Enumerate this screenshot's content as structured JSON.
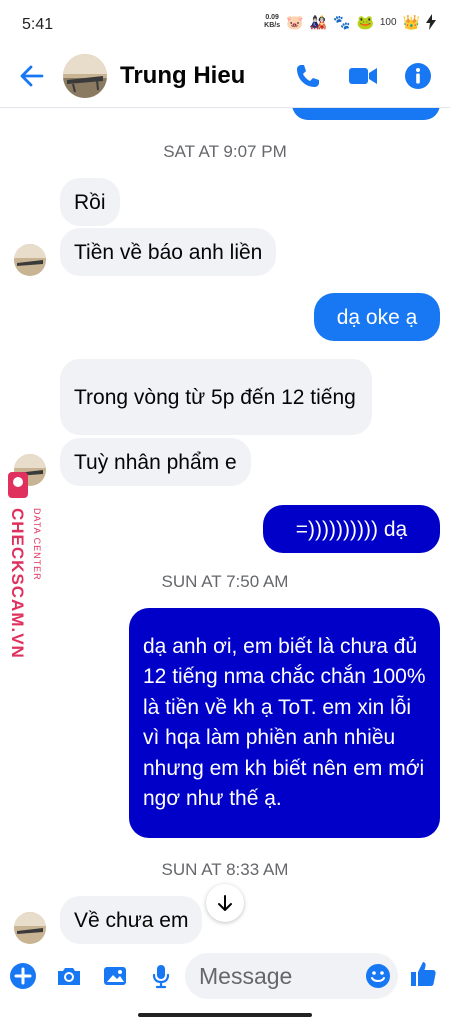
{
  "status_bar": {
    "time": "5:41",
    "net_speed": "0.09",
    "net_unit": "KB/s",
    "battery": "100"
  },
  "header": {
    "contact_name": "Trung Hieu"
  },
  "messages": [
    {
      "kind": "in",
      "text": "Rồi"
    },
    {
      "kind": "in",
      "text": "Tiền về báo anh liền"
    },
    {
      "kind": "out",
      "text": "dạ oke ạ"
    },
    {
      "kind": "in",
      "text": "Trong vòng từ 5p đến 12 tiếng"
    },
    {
      "kind": "in",
      "text": "Tuỳ nhân phẩm e"
    },
    {
      "kind": "out",
      "text": "=)))))))))) dạ"
    },
    {
      "kind": "out",
      "text": "dạ anh ơi, em biết là chưa đủ 12 tiếng nma chắc chắn 100% là tiền về kh ạ ToT. em xin lỗi vì hqa làm phiền anh nhiều nhưng em kh biết nên em mới ngơ như thế ạ."
    },
    {
      "kind": "in",
      "text": "Về chưa em"
    }
  ],
  "timestamps": [
    "SAT AT 9:07 PM",
    "SUN AT 7:50 AM",
    "SUN AT 8:33 AM"
  ],
  "watermark": {
    "line1": "DATA CENTER",
    "line2": "CHECKSCAM.VN"
  },
  "composer": {
    "placeholder": "Message"
  },
  "colors": {
    "accent": "#1877f2",
    "dark_bubble": "#0000c8",
    "incoming_bubble": "#f0f2f5"
  }
}
